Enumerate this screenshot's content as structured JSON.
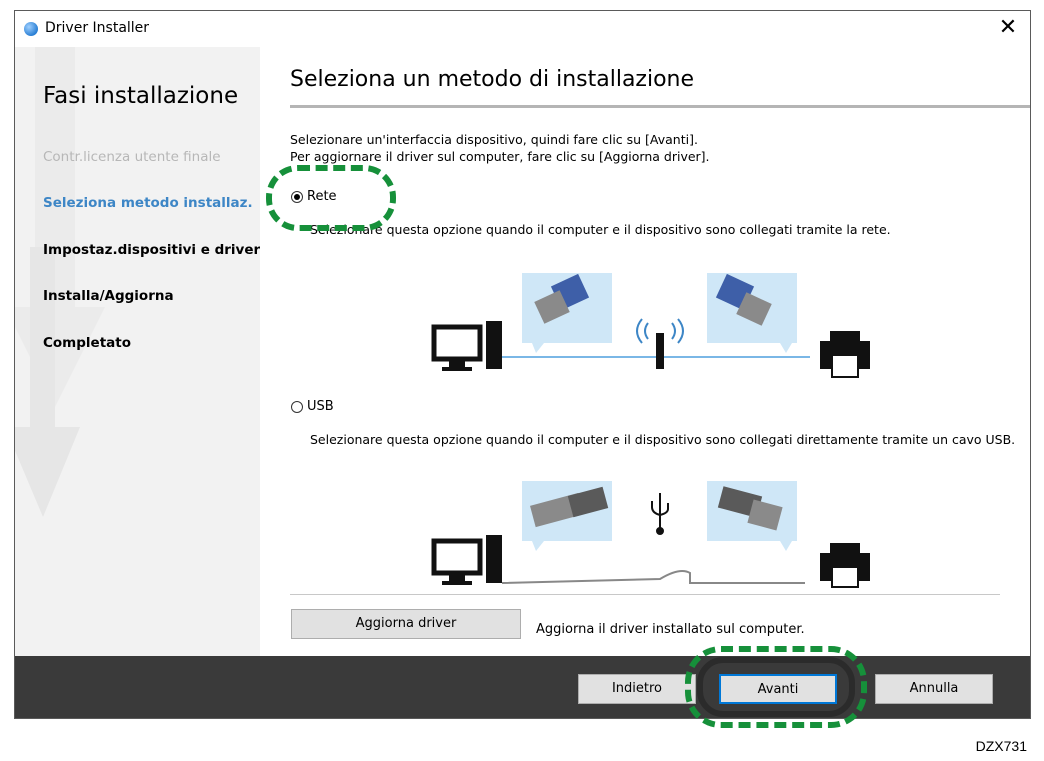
{
  "window": {
    "title": "Driver Installer",
    "close_glyph": "✕"
  },
  "sidebar": {
    "title": "Fasi installazione",
    "steps": [
      {
        "label": "Contr.licenza utente finale",
        "state": "done"
      },
      {
        "label": "Seleziona metodo installaz.",
        "state": "current"
      },
      {
        "label": "Impostaz.dispositivi e driver",
        "state": "pending"
      },
      {
        "label": "Installa/Aggiorna",
        "state": "pending"
      },
      {
        "label": "Completato",
        "state": "pending"
      }
    ]
  },
  "main": {
    "title": "Seleziona un metodo di installazione",
    "instructions": [
      "Selezionare un'interfaccia dispositivo, quindi fare clic su [Avanti].",
      "Per aggiornare il driver sul computer, fare clic su [Aggiorna driver]."
    ],
    "options": [
      {
        "label": "Rete",
        "selected": true,
        "description": "Selezionare questa opzione quando il computer e il dispositivo sono collegati tramite la rete."
      },
      {
        "label": "USB",
        "selected": false,
        "description": "Selezionare questa opzione quando il computer e il dispositivo sono collegati direttamente tramite un cavo USB."
      }
    ],
    "update_button": "Aggiorna driver",
    "update_description": "Aggiorna il driver installato sul computer."
  },
  "footer": {
    "back": "Indietro",
    "next": "Avanti",
    "cancel": "Annulla"
  },
  "colors": {
    "accent": "#3d86c6",
    "highlight": "#16903a",
    "footer": "#3a3a3a"
  },
  "caption": "DZX731"
}
